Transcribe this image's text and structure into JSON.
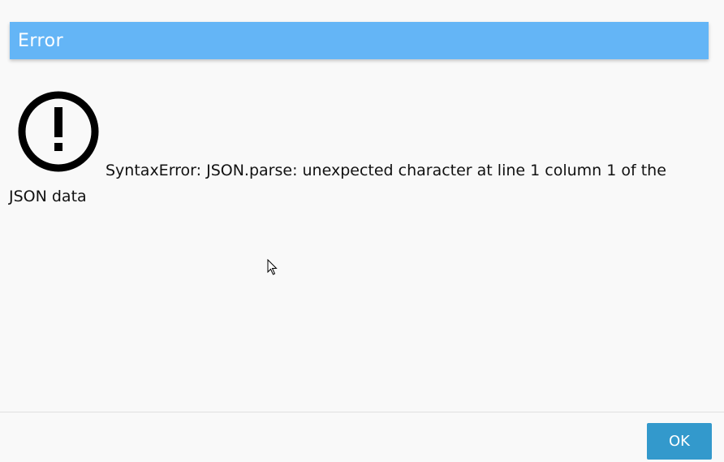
{
  "dialog": {
    "title": "Error",
    "icon": "exclamation-circle-icon",
    "message": "SyntaxError: JSON.parse: unexpected character at line 1 column 1 of the JSON data",
    "ok_label": "OK"
  },
  "colors": {
    "titlebar": "#64b5f6",
    "button": "#3399cc",
    "background": "#f9f9f9"
  }
}
